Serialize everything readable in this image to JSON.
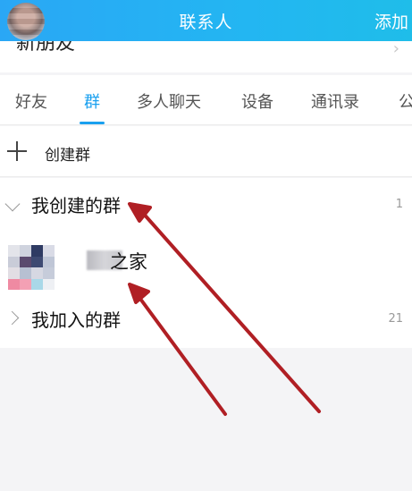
{
  "header": {
    "title": "联系人",
    "add_label": "添加"
  },
  "new_friends": {
    "label": "新朋友"
  },
  "tabs": [
    {
      "label": "好友",
      "active": false
    },
    {
      "label": "群",
      "active": true
    },
    {
      "label": "多人聊天",
      "active": false
    },
    {
      "label": "设备",
      "active": false
    },
    {
      "label": "通讯录",
      "active": false
    },
    {
      "label": "公",
      "active": false
    }
  ],
  "create_group": {
    "label": "创建群"
  },
  "sections": {
    "created": {
      "label": "我创建的群",
      "count": "1"
    },
    "joined": {
      "label": "我加入的群",
      "count": "21"
    }
  },
  "group_item": {
    "name_visible": "之家"
  },
  "colors": {
    "header_gradient_start": "#2aa7f5",
    "accent": "#1aa0ef",
    "annotation_arrow": "#b01f24"
  }
}
